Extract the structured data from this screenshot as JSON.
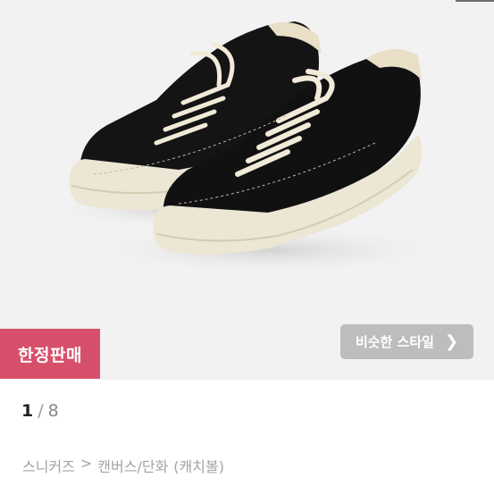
{
  "product": {
    "image_alt": "black canvas sneakers",
    "badge_label": "한정판매",
    "similar_button_label": "비슷한 스타일",
    "similar_button_icon": "chevron-right-icon"
  },
  "pagination": {
    "current": "1",
    "separator": "/",
    "total": "8"
  },
  "breadcrumb": {
    "category1": "스니커즈",
    "separator": ">",
    "category2": "캔버스/단화",
    "brand": "(캐치볼)"
  },
  "colors": {
    "badge": "#d6506b",
    "button": "#bdbdbd",
    "image_bg": "#f2f2f2"
  }
}
